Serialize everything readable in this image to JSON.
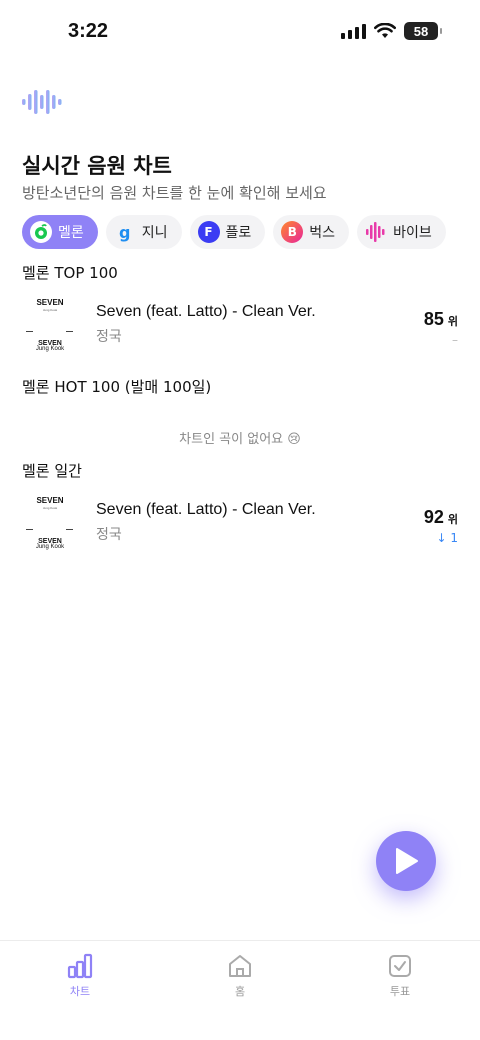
{
  "status_bar": {
    "time": "3:22",
    "battery": "58"
  },
  "header": {
    "title": "실시간 음원 차트",
    "subtitle": "방탄소년단의 음원 차트를 한 눈에 확인해 보세요"
  },
  "chips": [
    {
      "label": "멜론",
      "icon": "melon-icon",
      "color": "#ffffff",
      "active": true
    },
    {
      "label": "지니",
      "icon": "genie-icon",
      "color": "#1f8ef1"
    },
    {
      "label": "플로",
      "icon": "flo-icon",
      "color": "#3b3cf3"
    },
    {
      "label": "벅스",
      "icon": "bugs-icon",
      "color": "#f0402f"
    },
    {
      "label": "바이브",
      "icon": "vibe-icon",
      "color": "#e83aa9"
    }
  ],
  "sections": [
    {
      "title": "멜론 TOP 100",
      "song": {
        "title": "Seven (feat. Latto) - Clean Ver.",
        "artist": "정국",
        "rank": "85",
        "rank_unit": "위",
        "change": "–"
      }
    },
    {
      "title": "멜론 HOT 100 (발매 100일)",
      "empty_message": "차트인 곡이 없어요 😢"
    },
    {
      "title": "멜론 일간",
      "song": {
        "title": "Seven (feat. Latto) - Clean Ver.",
        "artist": "정국",
        "rank": "92",
        "rank_unit": "위",
        "change": "↓ 1"
      }
    }
  ],
  "album_art": {
    "title_text": "SEVEN",
    "artist_text": "Jung Kook"
  },
  "tab_bar": {
    "tabs": [
      {
        "label": "차트",
        "icon": "chart-icon",
        "active": true
      },
      {
        "label": "홈",
        "icon": "home-icon"
      },
      {
        "label": "투표",
        "icon": "vote-icon"
      }
    ]
  },
  "colors": {
    "accent": "#8f82f6",
    "rank_down": "#3a88f5"
  }
}
